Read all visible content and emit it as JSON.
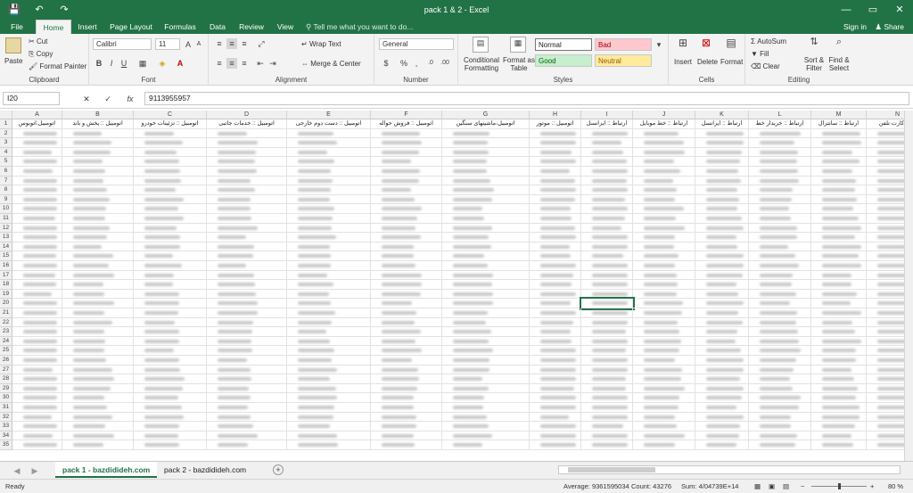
{
  "titlebar": {
    "title": "pack 1 & 2 - Excel",
    "save": "💾",
    "undo": "↶",
    "redo": "↷",
    "minimize": "—",
    "restore": "▭",
    "close": "✕"
  },
  "tabs": [
    "File",
    "Home",
    "Insert",
    "Page Layout",
    "Formulas",
    "Data",
    "Review",
    "View"
  ],
  "tell_me": "Tell me what you want to do...",
  "sign_in": "Sign in",
  "share": "Share",
  "ribbon": {
    "clipboard": {
      "label": "Clipboard",
      "paste": "Paste",
      "cut": "Cut",
      "copy": "Copy",
      "format_painter": "Format Painter"
    },
    "font": {
      "label": "Font",
      "family": "Calibri",
      "size": "11",
      "bold": "B",
      "italic": "I",
      "underline": "U"
    },
    "alignment": {
      "label": "Alignment",
      "wrap": "Wrap Text",
      "merge": "Merge & Center"
    },
    "number": {
      "label": "Number",
      "format": "General",
      "percent": "%",
      "comma": ","
    },
    "styles": {
      "label": "Styles",
      "conditional": "Conditional Formatting",
      "format_table": "Format as Table",
      "normal": "Normal",
      "bad": "Bad",
      "good": "Good",
      "neutral": "Neutral"
    },
    "cells": {
      "label": "Cells",
      "insert": "Insert",
      "delete": "Delete",
      "format": "Format"
    },
    "editing": {
      "label": "Editing",
      "autosum": "AutoSum",
      "fill": "Fill",
      "clear": "Clear",
      "sort": "Sort & Filter",
      "find": "Find & Select"
    }
  },
  "formula_bar": {
    "name_box": "I20",
    "fx": "fx",
    "value": "9113955957"
  },
  "columns": [
    {
      "letter": "A",
      "header": "اتومبیل.اتوبوس"
    },
    {
      "letter": "B",
      "header": "اتومبیل :: پخش و باند"
    },
    {
      "letter": "C",
      "header": "اتومبیل :: تزئینات خودرو"
    },
    {
      "letter": "D",
      "header": "اتومبیل :: خدمات جانبی"
    },
    {
      "letter": "E",
      "header": "اتومبیل :: دست دوم خارجی"
    },
    {
      "letter": "F",
      "header": "اتومبیل :: فروش حواله"
    },
    {
      "letter": "G",
      "header": "اتومبیل،ماشینهای سنگین"
    },
    {
      "letter": "H",
      "header": "اتومبیل :: موتور"
    },
    {
      "letter": "I",
      "header": "ارتباط :: ایرانسل"
    },
    {
      "letter": "J",
      "header": "ارتباط :: خط موبایل"
    },
    {
      "letter": "K",
      "header": "ارتباط :: ایرانسل"
    },
    {
      "letter": "L",
      "header": "ارتباط :: خریدار خط"
    },
    {
      "letter": "M",
      "header": "ارتباط :: سانترال"
    },
    {
      "letter": "N",
      "header": "ط :: کارت تلفن"
    }
  ],
  "rows": {
    "first": 1,
    "last": 35
  },
  "sheets": [
    "pack 1 - bazdidideh.com",
    "pack 2 - bazdidideh.com"
  ],
  "status": {
    "ready": "Ready",
    "average": "Average: 9361595034",
    "count": "Count: 43276",
    "sum": "Sum: 4/04739E+14",
    "zoom": "80 %"
  }
}
